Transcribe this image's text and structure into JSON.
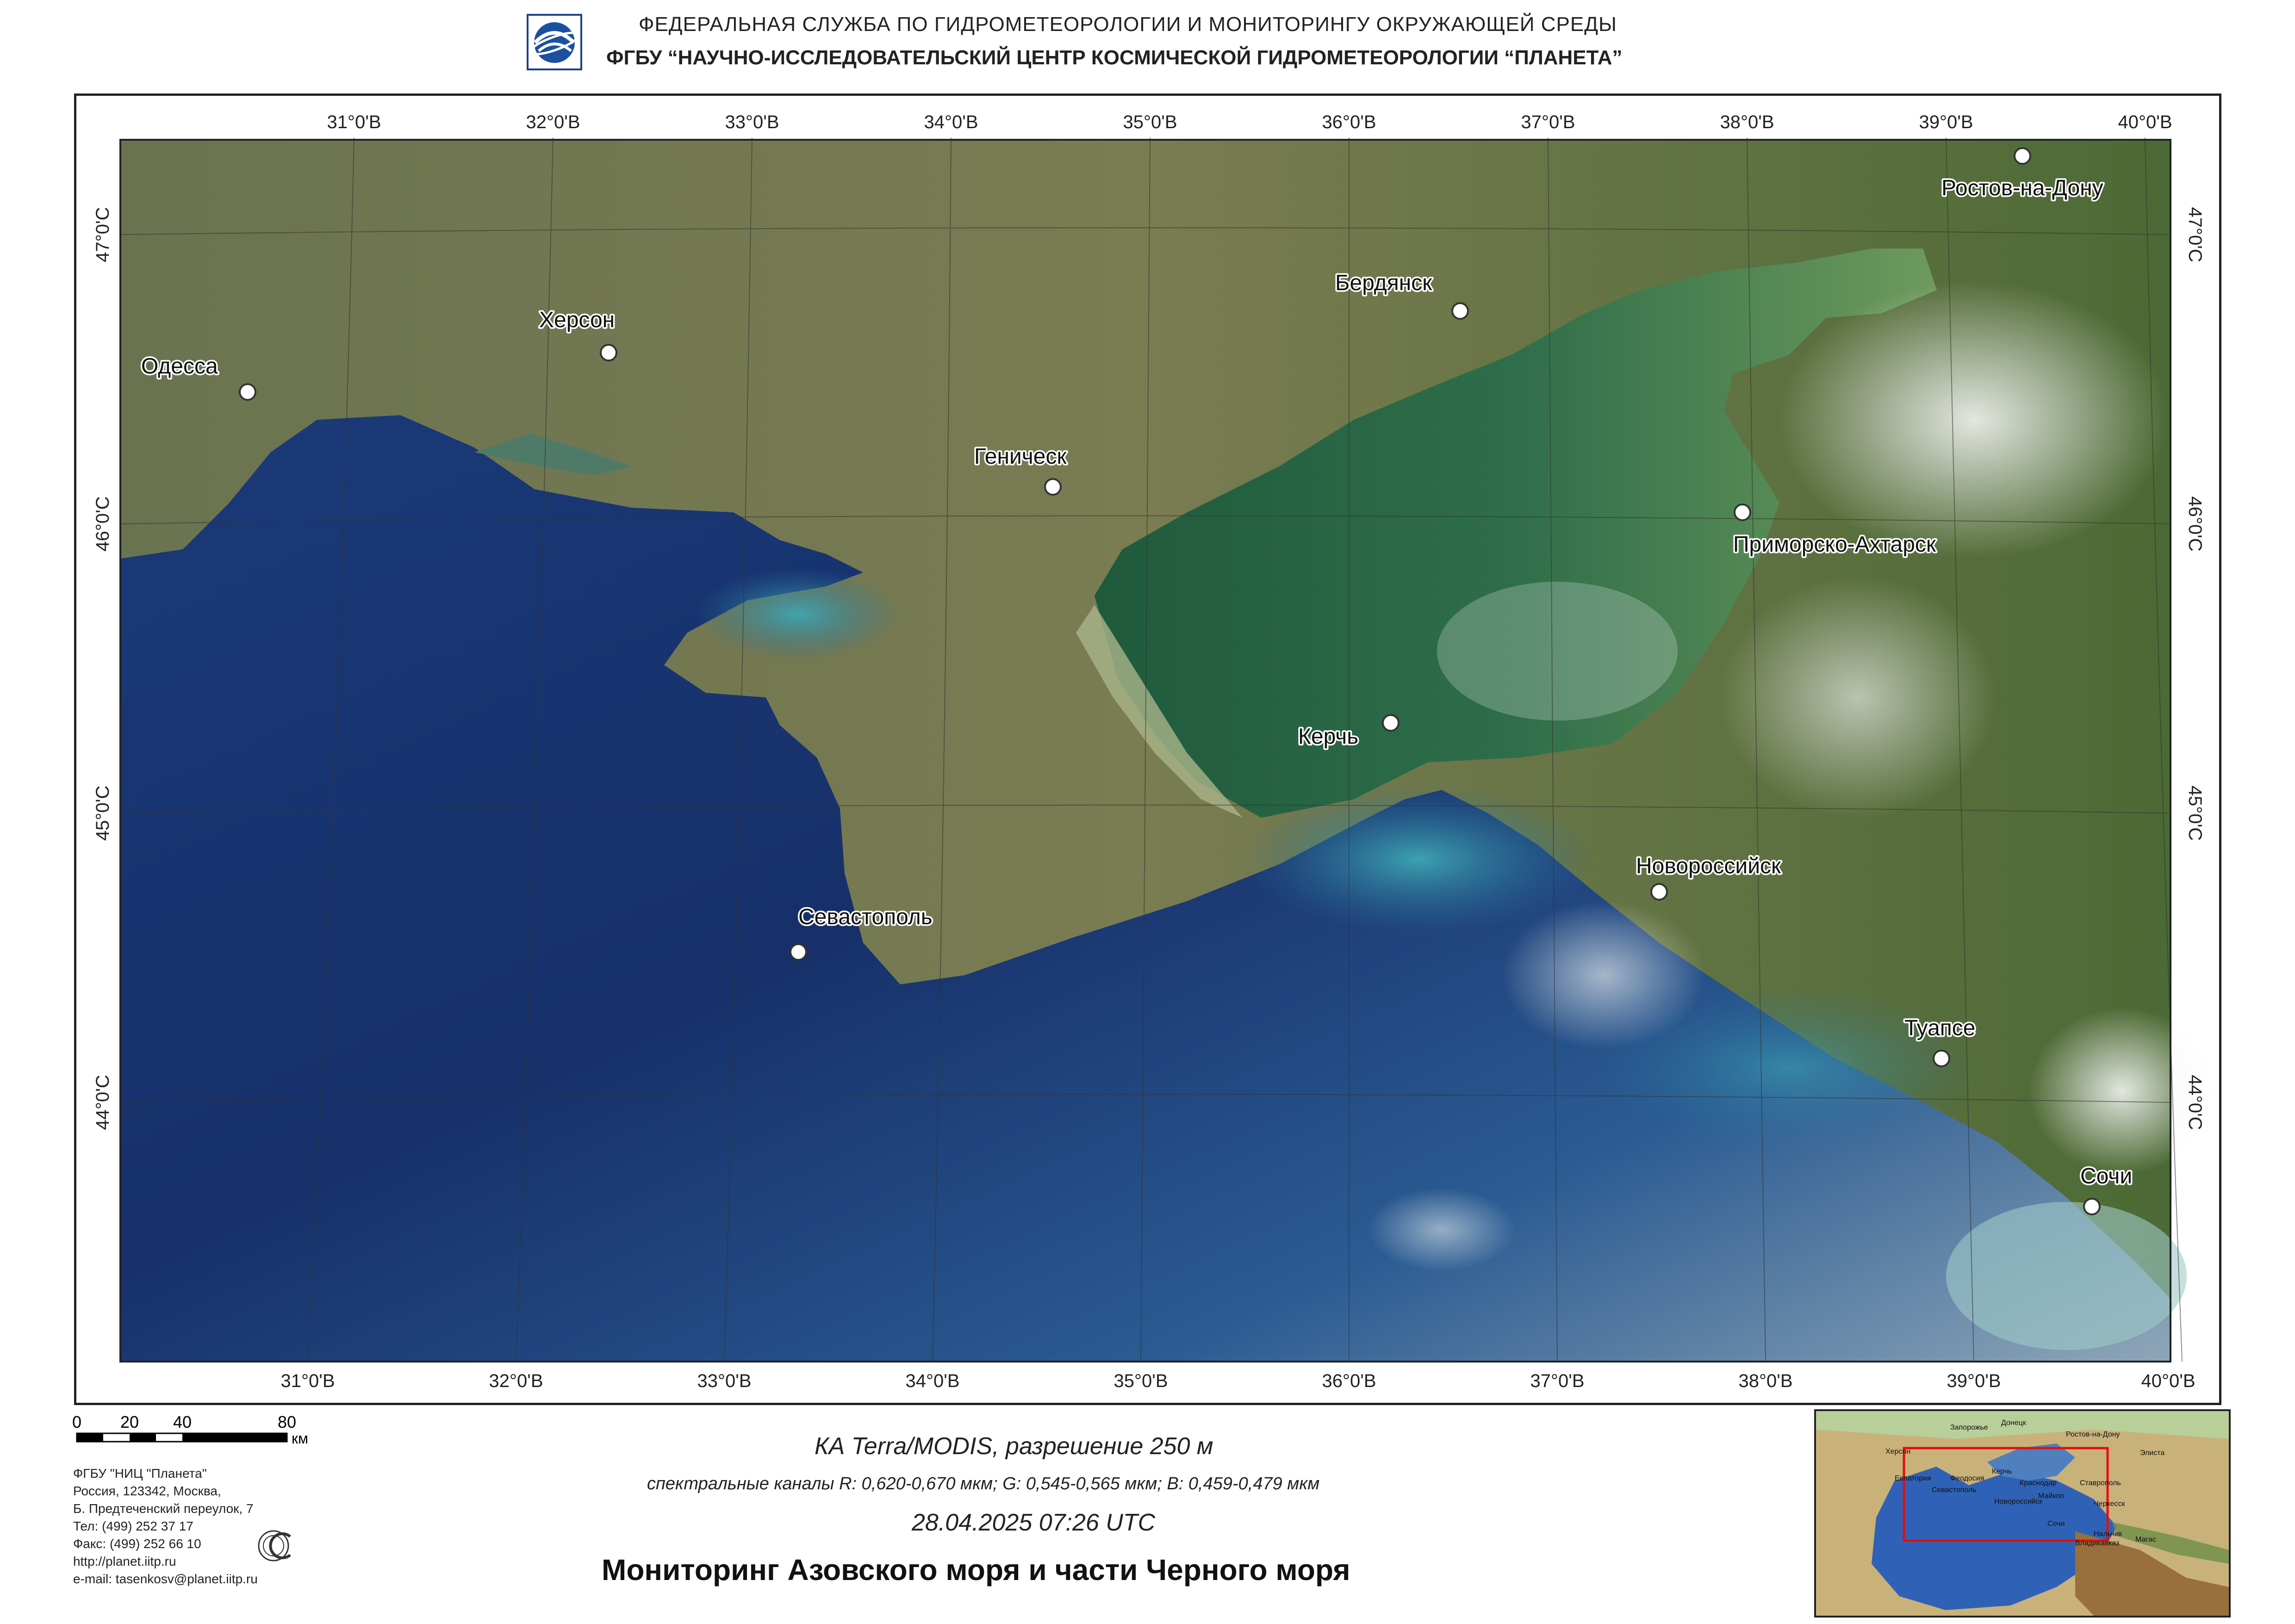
{
  "header": {
    "line1": "ФЕДЕРАЛЬНАЯ  СЛУЖБА  ПО ГИДРОМЕТЕОРОЛОГИИ И МОНИТОРИНГУ ОКРУЖАЮЩЕЙ СРЕДЫ",
    "line2": "ФГБУ “НАУЧНО-ИССЛЕДОВАТЕЛЬСКИЙ ЦЕНТР КОСМИЧЕСКОЙ ГИДРОМЕТЕОРОЛОГИИ “ПЛАНЕТА”",
    "logo_icon": "planeta-logo-icon"
  },
  "map": {
    "top_longitudes": [
      "31°0'В",
      "32°0'В",
      "33°0'В",
      "34°0'В",
      "35°0'В",
      "36°0'В",
      "37°0'В",
      "38°0'В",
      "39°0'В",
      "40°0'В"
    ],
    "bottom_longitudes": [
      "31°0'В",
      "32°0'В",
      "33°0'В",
      "34°0'В",
      "35°0'В",
      "36°0'В",
      "37°0'В",
      "38°0'В",
      "39°0'В",
      "40°0'В"
    ],
    "left_latitudes": [
      "47°0'С",
      "46°0'С",
      "45°0'С",
      "44°0'С"
    ],
    "right_latitudes": [
      "47°0'С",
      "46°0'С",
      "45°0'С",
      "44°0'С"
    ],
    "cities": [
      "Одесса",
      "Херсон",
      "Геническ",
      "Бердянск",
      "Ростов-на-Дону",
      "Приморско-Ахтарск",
      "Керчь",
      "Новороссийск",
      "Севастополь",
      "Туапсе",
      "Сочи"
    ],
    "colors": {
      "sea_deep": "#1b3a73",
      "sea_mid": "#25558f",
      "azov": "#2f6b4a",
      "land": "#6f7a4a",
      "cloud": "#e8ecec"
    }
  },
  "scale": {
    "ticks": [
      "0",
      "20",
      "40",
      "80"
    ],
    "unit": "км"
  },
  "org": {
    "lines": [
      "ФГБУ \"НИЦ \"Планета\"",
      "Россия, 123342,  Москва,",
      "Б. Предтеченский переулок, 7",
      "Тел: (499) 252 37 17",
      "Факс: (499) 252 66 10",
      "http://planet.iitp.ru",
      "e-mail: tasenkosv@planet.iitp.ru"
    ],
    "iso_icon": "iso-certification-icon"
  },
  "info": {
    "satellite": "КА Terra/MODIS, разрешение 250 м",
    "bands": "спектральные каналы R: 0,620-0,670 мкм; G: 0,545-0,565 мкм;  B: 0,459-0,479 мкм",
    "datetime": "28.04.2025   07:26 UTC",
    "title": "Мониторинг Азовского моря и части Черного моря"
  },
  "inset": {
    "labels": [
      "Запорожье",
      "Донецк",
      "Ростов-на-Дону",
      "Херсон",
      "Элиста",
      "Евпатория",
      "Феодосия",
      "Керчь",
      "Краснодар",
      "Ставрополь",
      "Севастополь",
      "Майкоп",
      "Новороссийск",
      "Черкесск",
      "Сочи",
      "Нальчик",
      "Владикавказ",
      "Магас"
    ]
  }
}
